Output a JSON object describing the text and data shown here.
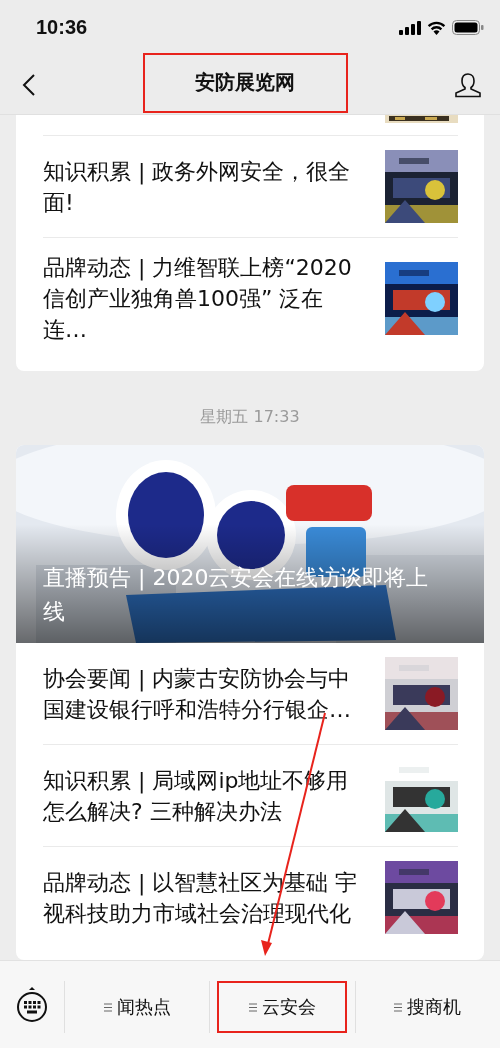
{
  "status_bar": {
    "time": "10:36"
  },
  "nav": {
    "title": "安防展览网",
    "highlighted": true
  },
  "feed": [
    {
      "items": [
        {
          "title": "知识积累 | 政务外网安全，很全面!"
        },
        {
          "title": "品牌动态 | 力维智联上榜“2020信创产业独角兽100强” 泛在连…"
        }
      ],
      "partial_top": true
    },
    {
      "time": "星期五 17:33",
      "cover": {
        "kind": "picture",
        "title": "直播预告 | 2020云安会在线访谈即将上线"
      },
      "items": [
        {
          "title": "协会要闻 | 内蒙古安防协会与中国建设银行呼和浩特分行银企…"
        },
        {
          "title": "知识积累 | 局域网ip地址不够用怎么解决? 三种解决办法"
        },
        {
          "title": "品牌动态 | 以智慧社区为基础 宇视科技助力市域社会治理现代化"
        }
      ]
    }
  ],
  "menus": [
    {
      "label": "闻热点",
      "highlighted": false
    },
    {
      "label": "云安会",
      "highlighted": true
    },
    {
      "label": "搜商机",
      "highlighted": false
    }
  ]
}
